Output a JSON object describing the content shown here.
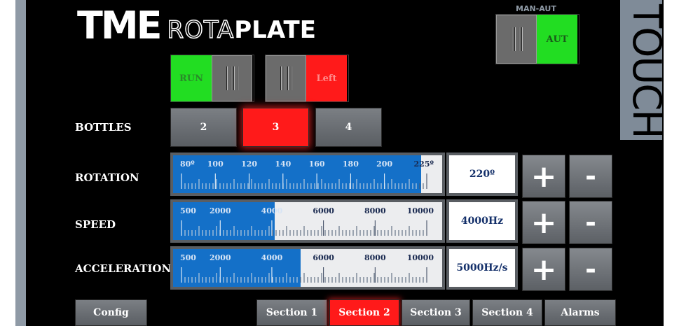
{
  "logo": {
    "tme": "TME",
    "rota": "ROTA",
    "plate": "PLATE"
  },
  "touch_label": "TOUCH",
  "man_aut": {
    "label": "MAN-AUT",
    "state": "AUT",
    "state_color": "#22dd22"
  },
  "run_toggle": {
    "state": "RUN",
    "state_color": "#22dd22"
  },
  "dir_toggle": {
    "state": "Left",
    "state_color": "#ff1a1a"
  },
  "bottles": {
    "label": "BOTTLES",
    "options": [
      "2",
      "3",
      "4"
    ],
    "selected": "3"
  },
  "rotation": {
    "label": "ROTATION",
    "min": 80,
    "max": 225,
    "value": 220,
    "display": "220º",
    "ticks": [
      "80º",
      "100",
      "120",
      "140",
      "160",
      "180",
      "200",
      "225º"
    ],
    "tick_values": [
      80,
      100,
      120,
      140,
      160,
      180,
      200,
      225
    ]
  },
  "speed": {
    "label": "SPEED",
    "min": 500,
    "max": 10000,
    "value": 4000,
    "display": "4000Hz",
    "ticks": [
      "500",
      "2000",
      "4000",
      "6000",
      "8000",
      "10000"
    ],
    "tick_values": [
      500,
      2000,
      4000,
      6000,
      8000,
      10000
    ]
  },
  "acceleration": {
    "label": "ACCELERATION",
    "min": 500,
    "max": 10000,
    "value": 5000,
    "display": "5000Hz/s",
    "ticks": [
      "500",
      "2000",
      "4000",
      "6000",
      "8000",
      "10000"
    ],
    "tick_values": [
      500,
      2000,
      4000,
      6000,
      8000,
      10000
    ]
  },
  "controls": {
    "plus": "+",
    "minus": "-"
  },
  "nav": {
    "config": "Config",
    "sections": [
      "Section 1",
      "Section 2",
      "Section 3",
      "Section 4"
    ],
    "active": "Section 2",
    "alarms": "Alarms"
  },
  "colors": {
    "accent_red": "#ff1a1a",
    "accent_green": "#22dd22",
    "slider_fill": "#1470c8"
  }
}
